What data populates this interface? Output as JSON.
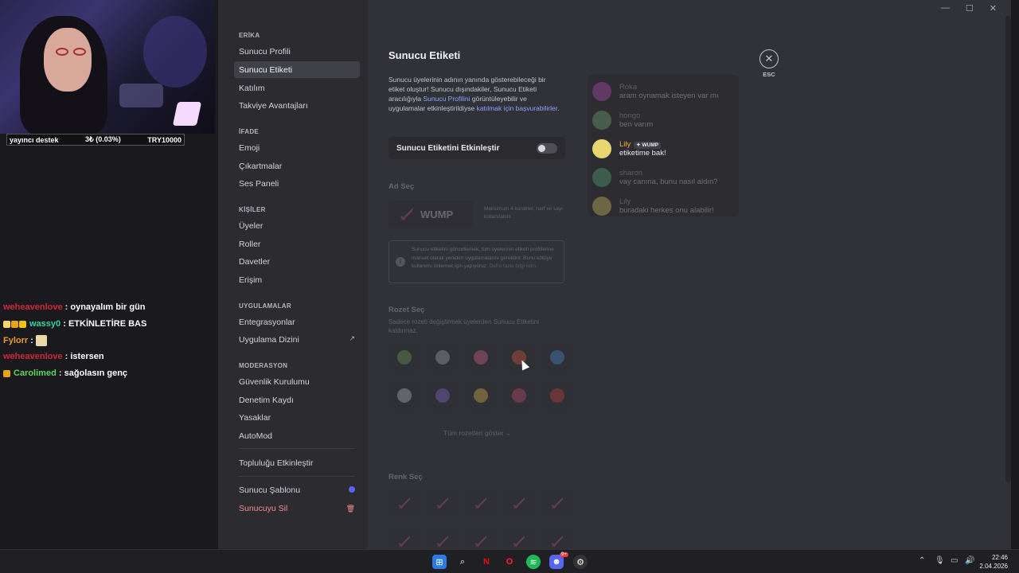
{
  "overlay": {
    "donation": {
      "label": "yayıncı destek",
      "amount": "3₺ (0.03%)",
      "goal": "TRY10000"
    },
    "chat": [
      {
        "user": "weheavenlove",
        "user_color": "#d1263a",
        "msg": "oynayalım bir gün",
        "badges": []
      },
      {
        "user": "wassy0",
        "user_color": "#2dd1a0",
        "msg": "ETKİNLETİRE BAS",
        "badges": [
          "#f5d76e",
          "#e8a317",
          "#f1c40f"
        ]
      },
      {
        "user": "Fylorr",
        "user_color": "#e89b2a",
        "msg": "",
        "badges": [],
        "emote": true
      },
      {
        "user": "weheavenlove",
        "user_color": "#d1263a",
        "msg": "istersen",
        "badges": []
      },
      {
        "user": "Carolimed",
        "user_color": "#5fd35f",
        "msg": "sağolasın genç",
        "badges": [
          "#e8a317"
        ]
      }
    ]
  },
  "sidebar": {
    "sections": [
      {
        "head": "ERİKA",
        "items": [
          "Sunucu Profili",
          "Sunucu Etiketi",
          "Katılım",
          "Takviye Avantajları"
        ]
      },
      {
        "head": "İFADE",
        "items": [
          "Emoji",
          "Çıkartmalar",
          "Ses Paneli"
        ]
      },
      {
        "head": "KİŞİLER",
        "items": [
          "Üyeler",
          "Roller",
          "Davetler",
          "Erişim"
        ]
      },
      {
        "head": "UYGULAMALAR",
        "items": [
          "Entegrasyonlar",
          "Uygulama Dizini"
        ]
      },
      {
        "head": "MODERASYON",
        "items": [
          "Güvenlik Kurulumu",
          "Denetim Kaydı",
          "Yasaklar",
          "AutoMod"
        ]
      }
    ],
    "community": "Topluluğu Etkinleştir",
    "template": "Sunucu Şablonu",
    "delete": "Sunucuyu Sil",
    "active": "Sunucu Etiketi"
  },
  "content": {
    "title": "Sunucu Etiketi",
    "desc_1": "Sunucu üyelerinin adının yanında gösterebileceği bir etiket oluştur! Sunucu dışındakiler, Sunucu Etiketi aracılığıyla ",
    "desc_link_1": "Sunucu Profilini",
    "desc_2": " görüntüleyebilir ve uygulamalar etkinleştirildiyse ",
    "desc_link_2": "katılmak için başvurabilirler",
    "desc_3": ".",
    "toggle_label": "Sunucu Etiketini Etkinleştir",
    "toggle_on": false,
    "name_label": "Ad Seç",
    "name_value": "WUMP",
    "name_hint": "Maksimum 4 karakter, harf ve sayı kullanılabilir.",
    "info": "Sunucu etiketini güncellemek, tüm üyelerinin etiketi profillerine manuel olarak yeniden uygulamalarını gerektirir. Bunu kötüye kullanımı önlemek için yapıyoruz.",
    "info_link": "Daha fazla bilgi edin.",
    "badge_label": "Rozet Seç",
    "badge_hint": "Sadece rozeti değiştirmek üyelerden Sunucu Etiketini kaldırmaz.",
    "show_all": "Tüm rozetleri göster",
    "color_label": "Renk Seç",
    "esc": "ESC"
  },
  "preview": [
    {
      "name": "Roka",
      "name_color": "#b5b5bc",
      "text": "aram oynamak isteyen var mı",
      "avatar": "#c84fc8",
      "faded": true
    },
    {
      "name": "hongo",
      "name_color": "#b5b5bc",
      "text": "ben varım",
      "avatar": "#7fb87f",
      "faded": true
    },
    {
      "name": "Lily",
      "name_color": "#f0b232",
      "text": "etiketime bak!",
      "avatar": "#e8d56e",
      "faded": false,
      "tag": "WUMP"
    },
    {
      "name": "sharon",
      "name_color": "#b5b5bc",
      "text": "vay canına, bunu nasıl aldın?",
      "avatar": "#5fb87f",
      "faded": true
    },
    {
      "name": "Lily",
      "name_color": "#b5b5bc",
      "text": "buradaki herkes onu alabilir!",
      "avatar": "#e8d56e",
      "faded": true
    }
  ],
  "taskbar": {
    "time": "22:46",
    "date": "2.04.2026",
    "discord_badge": "9+"
  }
}
